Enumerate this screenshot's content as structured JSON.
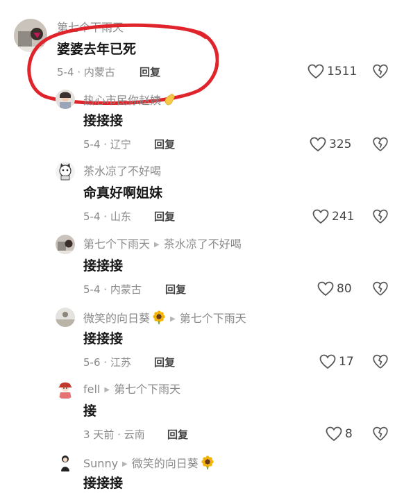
{
  "comments": [
    {
      "user": "第七个下雨天",
      "reply_to": "",
      "text": "婆婆去年已死",
      "date": "5-4",
      "location": "内蒙古",
      "reply_label": "回复",
      "likes": "1511",
      "emoji": ""
    },
    {
      "user": "热心市民你赵姨",
      "reply_to": "",
      "text": "接接接",
      "date": "5-4",
      "location": "辽宁",
      "reply_label": "回复",
      "likes": "325",
      "emoji": "hand"
    },
    {
      "user": "茶水凉了不好喝",
      "reply_to": "",
      "text": "命真好啊姐妹",
      "date": "5-4",
      "location": "山东",
      "reply_label": "回复",
      "likes": "241",
      "emoji": ""
    },
    {
      "user": "第七个下雨天",
      "reply_to": "茶水凉了不好喝",
      "text": "接接接",
      "date": "5-4",
      "location": "内蒙古",
      "reply_label": "回复",
      "likes": "80",
      "emoji": ""
    },
    {
      "user": "微笑的向日葵",
      "reply_to": "第七个下雨天",
      "text": "接接接",
      "date": "5-6",
      "location": "江苏",
      "reply_label": "回复",
      "likes": "17",
      "emoji": "sunflower"
    },
    {
      "user": "fell",
      "reply_to": "第七个下雨天",
      "text": "接",
      "date": "3 天前",
      "location": "云南",
      "reply_label": "回复",
      "likes": "8",
      "emoji": ""
    },
    {
      "user": "Sunny",
      "reply_to": "微笑的向日葵",
      "text": "接接接",
      "date": "",
      "location": "",
      "reply_label": "",
      "likes": "",
      "emoji": "sunflower-after-reply"
    }
  ],
  "meta_separator": "·",
  "icons": {
    "like": "heart-outline-icon",
    "dislike": "broken-heart-icon",
    "reply_arrow": "triangle-right-icon"
  },
  "annotation_color": "#e0242b"
}
